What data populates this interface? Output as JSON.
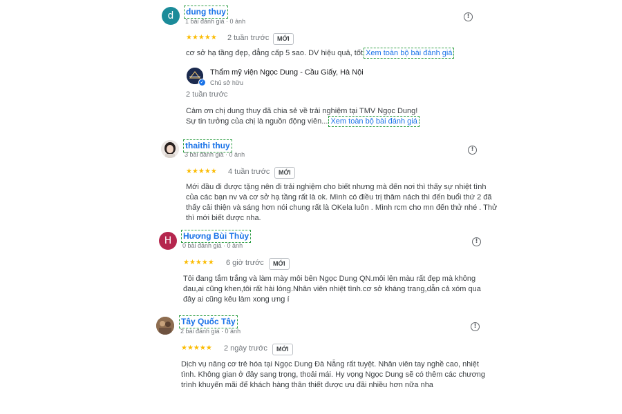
{
  "reviews": [
    {
      "avatar_letter": "d",
      "avatar_color": "#1b8b99",
      "name": "dung thuy",
      "meta": "1 bài đánh giá · 0 ảnh",
      "stars": "★★★★★",
      "when": "2 tuần trước",
      "badge": "MỚI",
      "text": "cơ sở hạ tầng đẹp, đẳng cấp 5 sao. DV hiệu quả, tốt",
      "more": "Xem toàn bộ bài đánh giá",
      "owner": {
        "name": "Thẩm mỹ viện Ngọc Dung - Cầu Giấy, Hà Nội",
        "role": "Chủ sở hữu",
        "when": "2 tuần trước",
        "line1": "Cảm ơn chị dung thuy đã chia sẻ về trải nghiệm tại TMV Ngọc Dung!",
        "line2": "Sự tin tưởng của chị là nguồn động viên...",
        "more": "Xem toàn bộ bài đánh giá"
      }
    },
    {
      "name": "thaithi thuy",
      "meta": "3 bài đánh giá · 0 ảnh",
      "stars": "★★★★★",
      "when": "4 tuần trước",
      "badge": "MỚI",
      "lines": [
        "Mới đầu đi được tặng nên đi trải nghiệm cho biết nhưng mà đến nơi thì thấy sự nhiệt tình",
        "của các bạn nv và cơ sở hạ tầng rất là ok. Mình có điều trị thâm nách thì đến buổi thứ 2 đã",
        "thấy cải thiện và sáng hơn nói chung rất là OKela luôn . Mình rcm cho mn đến thử nhé . Thử",
        "thì mới biết được nha."
      ]
    },
    {
      "avatar_letter": "H",
      "avatar_color": "#b5264e",
      "name": "Hương Bùi Thùy",
      "meta": "0 bài đánh giá · 0 ảnh",
      "stars": "★★★★★",
      "when": "6 giờ trước",
      "badge": "MỚI",
      "lines": [
        "Tôi đang tắm trắng và làm mày môi bên Ngọc Dung QN.môi lên màu rất đẹp mà không",
        "đau,ai cũng khen,tôi rất hài lòng.Nhân viên nhiệt tình.cơ sở kháng trang,dẫn cả xóm qua",
        "đây ai cũng kêu làm xong ưng í"
      ]
    },
    {
      "name": "Tây Quốc Tây",
      "meta": "2 bài đánh giá · 0 ảnh",
      "stars": "★★★★★",
      "when": "2 ngày trước",
      "badge": "MỚI",
      "lines": [
        "Dịch vụ nâng cơ trẻ hóa tại Ngọc Dung Đà Nẵng rất tuyệt. Nhân viên tay nghề cao, nhiệt",
        "tình. Không gian ở đây sang trọng, thoải mái. Hy vọng Ngọc Dung sẽ có thêm các chương",
        "trình khuyến mãi để khách hàng thân thiết được ưu đãi nhiều hơn nữa nha"
      ]
    }
  ],
  "flag_symbol": "!"
}
